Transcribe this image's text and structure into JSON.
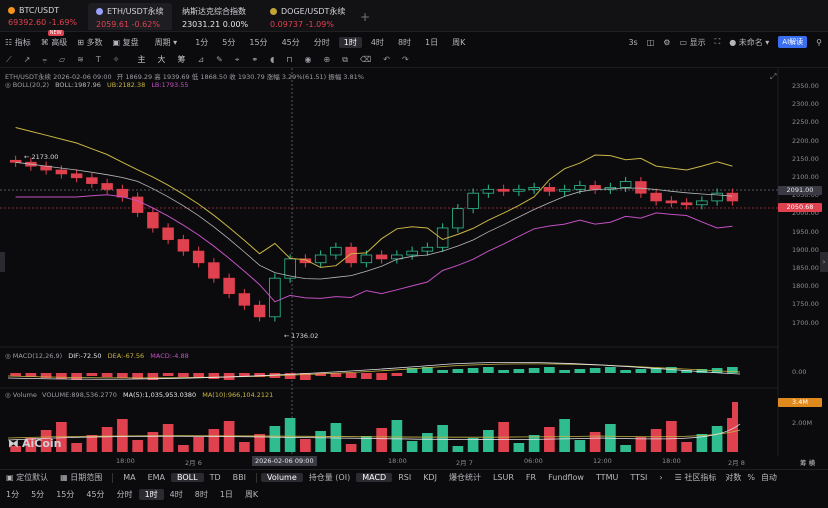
{
  "tickers": [
    {
      "name": "BTC/USDT",
      "price": "69392.60",
      "change": "-1.69%",
      "dot_color": "#f7931a"
    },
    {
      "name": "ETH/USDT永续",
      "price": "2059.61",
      "change": "-0.62%",
      "dot_color": "#9aa0ff"
    },
    {
      "name": "纳斯达克综合指数",
      "price": "23031.21",
      "change": "0.00%",
      "dot_color": ""
    },
    {
      "name": "DOGE/USDT永续",
      "price": "0.09737",
      "change": "-1.09%",
      "dot_color": "#c2a633"
    }
  ],
  "add_tab": "+",
  "toolbar": {
    "indicator": "指标",
    "advanced": "高级",
    "new_badge": "NEW",
    "multi": "多数",
    "review": "复盘",
    "period": "周期",
    "intervals": [
      "1分",
      "5分",
      "15分",
      "45分",
      "分时",
      "1时",
      "4时",
      "8时",
      "1日",
      "周K"
    ],
    "selected_interval": "1时",
    "right": {
      "countdown": "3s",
      "display": "显示",
      "user": "未命名",
      "ai": "AI解读"
    }
  },
  "draw_tools": {
    "main": "主",
    "big": "大",
    "chip": "筹"
  },
  "chart_legend": {
    "symbol_line": "ETH/USDT永续 2026-02-06 09:00",
    "ohlc": "开 1869.29  高 1939.69  低 1868.50  收 1930.79  涨幅 3.29%(61.51)  振幅 3.81%",
    "boll_name": "BOLL(20,2)",
    "boll_mid": "BOLL:1987.96",
    "boll_ub": "UB:2182.38",
    "boll_lb": "LB:1793.55"
  },
  "annotations": {
    "high": "2173.00",
    "low": "1736.02"
  },
  "price_axis": [
    "2350.00",
    "2300.00",
    "2250.00",
    "2200.00",
    "2150.00",
    "2100.00",
    "2050.00",
    "2000.00",
    "1950.00",
    "1900.00",
    "1850.00",
    "1800.00",
    "1750.00",
    "1700.00"
  ],
  "price_tags": {
    "crosshair": "2091.00",
    "current": "2050.68"
  },
  "macd_legend": {
    "name": "MACD(12,26,9)",
    "dif": "DIF:-72.50",
    "dea": "DEA:-67.56",
    "macd": "MACD:-4.88"
  },
  "macd_axis": "0.00",
  "volume_legend": {
    "name": "Volume",
    "vol": "VOLUME:898,536.2770",
    "ma5": "MA(5):1,035,953.0380",
    "ma10": "MA(10):966,104.2121"
  },
  "volume_axis": {
    "tag": "3.4M",
    "tick": "2.00M"
  },
  "x_axis": [
    "18:00",
    "2月 6",
    "06:00",
    "18:00",
    "2月 7",
    "06:00",
    "12:00",
    "18:00",
    "2月 8"
  ],
  "x_cursor": "2026-02-06 09:00",
  "x_right": "筹 横",
  "watermark": "AiCoin",
  "bottom_bar": {
    "left": [
      "定位默认",
      "日期范围"
    ],
    "indicators": [
      "MA",
      "EMA",
      "BOLL",
      "TD",
      "BBI"
    ],
    "selected_main": "BOLL",
    "sub": [
      "Volume",
      "持仓量 (OI)",
      "MACD",
      "RSI",
      "KDJ",
      "爆仓统计",
      "LSUR",
      "FR",
      "Fundflow",
      "TTMU",
      "TTSI"
    ],
    "selected_sub": [
      "Volume",
      "MACD"
    ],
    "right": [
      "社区指标",
      "对数",
      "%",
      "自动"
    ]
  },
  "bottom_intervals": [
    "1分",
    "5分",
    "15分",
    "45分",
    "分时",
    "1时",
    "4时",
    "8时",
    "1日",
    "周K"
  ],
  "chart_data": {
    "type": "candlestick",
    "ylim": [
      1700,
      2360
    ],
    "candles_close_trend": [
      2160,
      2150,
      2140,
      2130,
      2120,
      2105,
      2090,
      2070,
      2030,
      1990,
      1960,
      1930,
      1900,
      1860,
      1820,
      1790,
      1760,
      1860,
      1910,
      1900,
      1920,
      1940,
      1900,
      1920,
      1910,
      1920,
      1930,
      1940,
      1990,
      2040,
      2080,
      2090,
      2085,
      2090,
      2095,
      2085,
      2090,
      2100,
      2090,
      2095,
      2110,
      2080,
      2060,
      2055,
      2050,
      2060,
      2080,
      2060
    ]
  },
  "colors": {
    "up": "#2fbd8f",
    "down": "#e0414f",
    "boll_ub": "#c9b545",
    "boll_lb": "#c451c4",
    "boll_mid": "#b9b9b9"
  }
}
